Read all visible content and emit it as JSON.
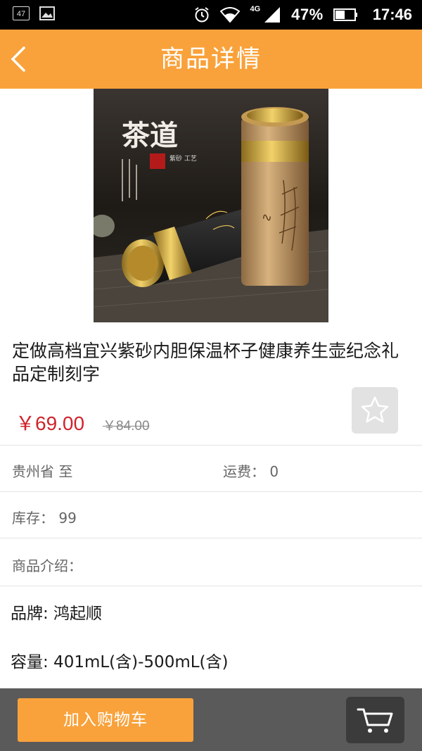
{
  "status_bar": {
    "notif_count": "47",
    "network": "4G",
    "battery_percent": "47%",
    "time": "17:46"
  },
  "header": {
    "title": "商品详情"
  },
  "product": {
    "image_text": {
      "calligraphy": "茶道",
      "seal": "紫砂 工艺"
    },
    "name": "定做高档宜兴紫砂内胆保温杯子健康养生壶纪念礼品定制刻字",
    "price": "￥69.00",
    "original_price": "￥84.00"
  },
  "info": {
    "origin": "贵州省 至",
    "shipping_label": "运费：",
    "shipping_value": "0",
    "stock_label": "库存：",
    "stock_value": "99",
    "intro_label": "商品介绍："
  },
  "specs": [
    {
      "text": "品牌: 鸿起顺"
    },
    {
      "text": "容量: 401mL(含)-500mL(含)"
    }
  ],
  "bottom_bar": {
    "add_to_cart_label": "加入购物车"
  },
  "colors": {
    "accent": "#f9a23b",
    "price": "#d0232c",
    "bottom_bar": "#5a5a5a"
  }
}
